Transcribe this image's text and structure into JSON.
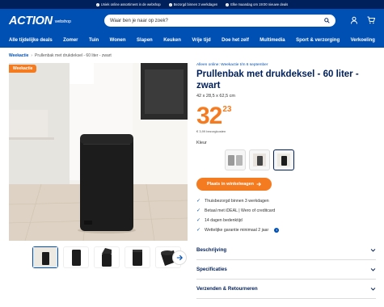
{
  "topbar": {
    "usps": [
      "Uniek online assortiment in de webshop",
      "Bezorgd binnen 3 werkdagen",
      "Elke maandag om 19:00 nieuwe deals"
    ]
  },
  "header": {
    "logo": "ACTION",
    "logo_sub": "webshop",
    "search_placeholder": "Waar ben je naar op zoek?"
  },
  "nav": {
    "items": [
      "Alle tijdelijke deals",
      "Zomer",
      "Tuin",
      "Wonen",
      "Slapen",
      "Keuken",
      "Vrije tijd",
      "Doe het zelf",
      "Multimedia",
      "Sport & verzorging",
      "Verkoeling"
    ]
  },
  "breadcrumb": {
    "parent": "Weekactie",
    "current": "Prullenbak met drukdeksel - 60 liter - zwart"
  },
  "product": {
    "badge": "Weekactie",
    "online_note": "Alleen online: Weekactie t/m 6 september",
    "title": "Prullenbak met drukdeksel - 60 liter - zwart",
    "dimensions": "42 x 28,5 x 62,5 cm",
    "price_euros": "32",
    "price_cents": "23",
    "price_note": "€ 3,99 bezorgkosten",
    "color_label": "Kleur",
    "cta_label": "Plaats in winkelwagen",
    "usps": [
      "Thuisbezorgd binnen 3 werkdagen",
      "Betaal met iDEAL | Wero of creditcard",
      "14 dagen bedenktijd",
      "Wettelijke garantie minimaal 2 jaar"
    ]
  },
  "accordions": [
    "Beschrijving",
    "Specificaties",
    "Verzenden & Retourneren"
  ],
  "colors": {
    "brand": "#0050b3",
    "dark": "#00205b",
    "accent": "#f47b20"
  }
}
